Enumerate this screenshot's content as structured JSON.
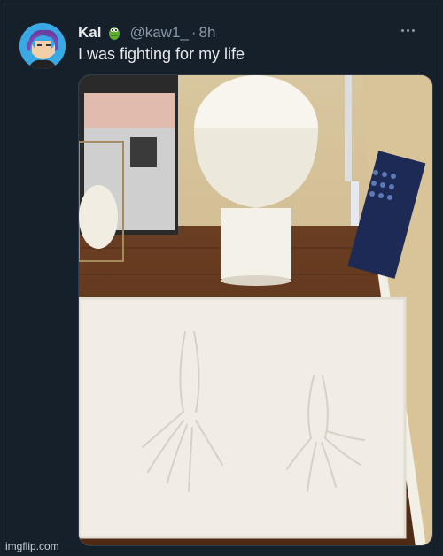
{
  "tweet": {
    "display_name": "Kal",
    "emoji_icon": "crocodile-emoji-icon",
    "handle": "@kaw1_",
    "dot": "·",
    "time": "8h",
    "text": "I was fighting for my life",
    "more_icon": "more-options-icon"
  },
  "media": {
    "description_icon": "bathroom-photo"
  },
  "watermark": "imgflip.com",
  "colors": {
    "background": "#15202b",
    "text_primary": "#e7e9ea",
    "text_secondary": "#8b98a5"
  }
}
